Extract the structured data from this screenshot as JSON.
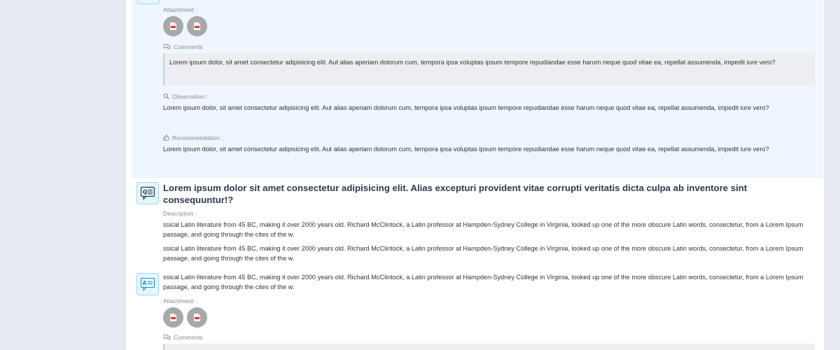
{
  "attachment_label": "Attachment :",
  "comments_label": "Comments",
  "observation_label": "Observation :",
  "recommendation_label": "Recommendation :",
  "description_label": "Description :",
  "lorem_short": "Lorem ipsum dolor, sit amet consectetur adipisicing elit. Aut alias aperiam dolorum cum, tempora ipsa voluptas ipsum tempore repudiandae esse harum neque quod vitae ea, repellat assumenda, impedit iure vero?",
  "item2": {
    "title": "Lorem ipsum dolor sit amet consectetur adipisicing elit. Alias excepturi provident vitae corrupti veritatis dicta culpa ab inventore sint consequuntur!?",
    "desc_1": "ssical Latin literature from 45 BC, making it over 2000 years old. Richard McClintock, a Latin professor at Hampden-Sydney College in Virginia, looked up one of the more obscure Latin words, consectetur, from a Lorem Ipsum passage, and going through the cites of the w.",
    "desc_2": "ssical Latin literature from 45 BC, making it over 2000 years old. Richard McClintock, a Latin professor at Hampden-Sydney College in Virginia, looked up one of the more obscure Latin words, consectetur, from a Lorem Ipsum passage, and going through the cites of the w.",
    "answer": "ssical Latin literature from 45 BC, making it over 2000 years old. Richard McClintock, a Latin professor at Hampden-Sydney College in Virginia, looked up one of the more obscure Latin words, consectetur, from a Lorem Ipsum passage, and going through the cites of the w."
  },
  "icons": {
    "pdf": "pdf-file-icon",
    "comments": "comments-icon",
    "observation": "search-icon",
    "recommendation": "thumbs-up-icon",
    "question": "question-card-icon",
    "answer": "answer-card-icon"
  },
  "colors": {
    "page_bg": "#e6ebf1",
    "highlight_bg": "#eff6ff",
    "icon_border": "#9fd7f0",
    "icon_fill": "#e4f6fd",
    "title": "#2b3a4a"
  }
}
